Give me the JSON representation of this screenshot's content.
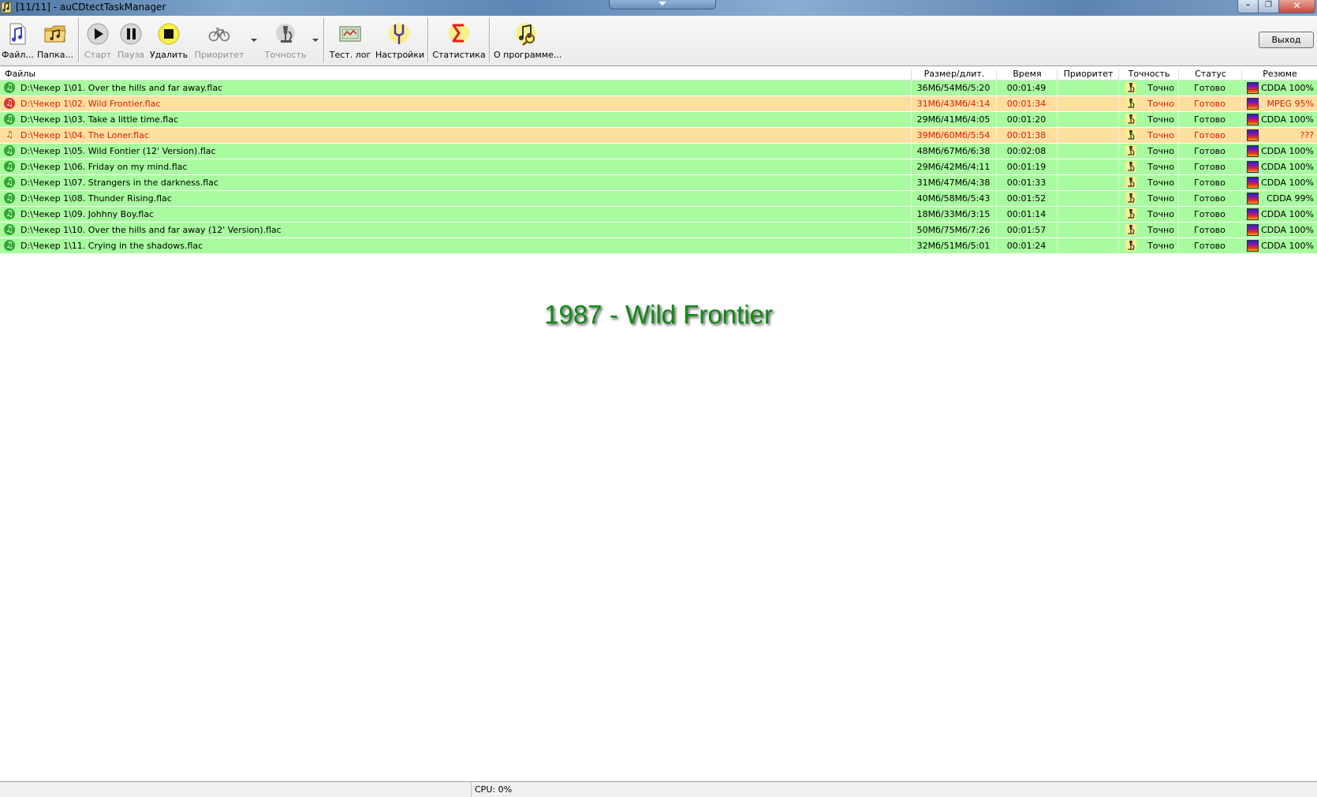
{
  "window": {
    "title": "[11/11] - auCDtectTaskManager"
  },
  "toolbar": {
    "buttons": [
      {
        "id": "files",
        "label": "Файл...",
        "icon": "music-file-icon",
        "enabled": true
      },
      {
        "id": "folder",
        "label": "Папка...",
        "icon": "music-folder-icon",
        "enabled": true
      },
      {
        "id": "start",
        "label": "Старт",
        "icon": "play-icon",
        "enabled": false
      },
      {
        "id": "pause",
        "label": "Пауза",
        "icon": "pause-icon",
        "enabled": false
      },
      {
        "id": "delete",
        "label": "Удалить",
        "icon": "stop-icon",
        "enabled": true
      },
      {
        "id": "priority",
        "label": "Приоритет",
        "icon": "bicycle-icon",
        "enabled": false
      },
      {
        "id": "accuracy",
        "label": "Точность",
        "icon": "microscope-icon",
        "enabled": false
      },
      {
        "id": "testlog",
        "label": "Тест. лог",
        "icon": "log-icon",
        "enabled": true
      },
      {
        "id": "settings",
        "label": "Настройки",
        "icon": "tuning-fork-icon",
        "enabled": true
      },
      {
        "id": "stats",
        "label": "Статистика",
        "icon": "sigma-icon",
        "enabled": true
      },
      {
        "id": "about",
        "label": "О программе...",
        "icon": "about-icon",
        "enabled": true
      }
    ],
    "exit_label": "Выход"
  },
  "table": {
    "headers": {
      "files": "Файлы",
      "size": "Размер/длит.",
      "time": "Время",
      "priority": "Приоритет",
      "accuracy": "Точность",
      "status": "Статус",
      "result": "Резюме"
    },
    "rows": [
      {
        "file": "D:\\Чекер 1\\01. Over the hills and far away.flac",
        "size": "36Мб/54Мб/5:20",
        "time": "00:01:49",
        "priority": "",
        "accuracy": "Точно",
        "status": "Готово",
        "result": "CDDA 100%",
        "state": "ok"
      },
      {
        "file": "D:\\Чекер 1\\02. Wild Frontier.flac",
        "size": "31Мб/43Мб/4:14",
        "time": "00:01:34",
        "priority": "",
        "accuracy": "Точно",
        "status": "Готово",
        "result": "MPEG 95%",
        "state": "warn"
      },
      {
        "file": "D:\\Чекер 1\\03. Take a little time.flac",
        "size": "29Мб/41Мб/4:05",
        "time": "00:01:20",
        "priority": "",
        "accuracy": "Точно",
        "status": "Готово",
        "result": "CDDA 100%",
        "state": "ok"
      },
      {
        "file": "D:\\Чекер 1\\04. The Loner.flac",
        "size": "39Мб/60Мб/5:54",
        "time": "00:01:38",
        "priority": "",
        "accuracy": "Точно",
        "status": "Готово",
        "result": "???",
        "state": "warn"
      },
      {
        "file": "D:\\Чекер 1\\05. Wild Fontier (12' Version).flac",
        "size": "48Мб/67Мб/6:38",
        "time": "00:02:08",
        "priority": "",
        "accuracy": "Точно",
        "status": "Готово",
        "result": "CDDA 100%",
        "state": "ok"
      },
      {
        "file": "D:\\Чекер 1\\06. Friday on my mind.flac",
        "size": "29Мб/42Мб/4:11",
        "time": "00:01:19",
        "priority": "",
        "accuracy": "Точно",
        "status": "Готово",
        "result": "CDDA 100%",
        "state": "ok"
      },
      {
        "file": "D:\\Чекер 1\\07. Strangers in the darkness.flac",
        "size": "31Мб/47Мб/4:38",
        "time": "00:01:33",
        "priority": "",
        "accuracy": "Точно",
        "status": "Готово",
        "result": "CDDA 100%",
        "state": "ok"
      },
      {
        "file": "D:\\Чекер 1\\08. Thunder Rising.flac",
        "size": "40Мб/58Мб/5:43",
        "time": "00:01:52",
        "priority": "",
        "accuracy": "Точно",
        "status": "Готово",
        "result": "CDDA 99%",
        "state": "ok"
      },
      {
        "file": "D:\\Чекер 1\\09. Johhny Boy.flac",
        "size": "18Мб/33Мб/3:15",
        "time": "00:01:14",
        "priority": "",
        "accuracy": "Точно",
        "status": "Готово",
        "result": "CDDA 100%",
        "state": "ok"
      },
      {
        "file": "D:\\Чекер 1\\10. Over the hills and far away (12' Version).flac",
        "size": "50Мб/75Мб/7:26",
        "time": "00:01:57",
        "priority": "",
        "accuracy": "Точно",
        "status": "Готово",
        "result": "CDDA 100%",
        "state": "ok"
      },
      {
        "file": "D:\\Чекер 1\\11. Crying in the shadows.flac",
        "size": "32Мб/51Мб/5:01",
        "time": "00:01:24",
        "priority": "",
        "accuracy": "Точно",
        "status": "Готово",
        "result": "CDDA 100%",
        "state": "ok"
      }
    ]
  },
  "album_title": "1987 - Wild Frontier",
  "statusbar": {
    "cpu": "CPU: 0%"
  },
  "colors": {
    "row_ok": "#a8fb9f",
    "row_warn": "#fde0a0",
    "warn_text": "#e0180b",
    "album_title": "#0e8a14"
  }
}
